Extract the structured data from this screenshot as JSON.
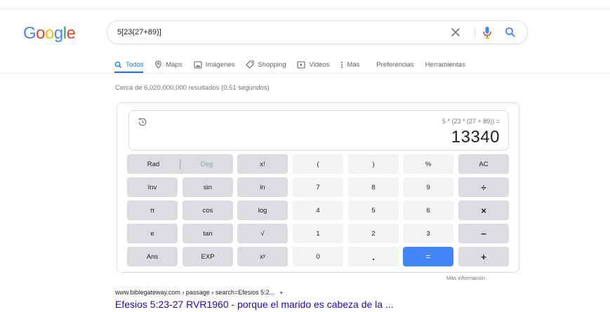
{
  "logo": {
    "letters": [
      "G",
      "o",
      "o",
      "g",
      "l",
      "e"
    ],
    "colors": [
      "#4285f4",
      "#ea4335",
      "#fbbc05",
      "#4285f4",
      "#34a853",
      "#ea4335"
    ]
  },
  "search": {
    "query": "5[23(27+89)]"
  },
  "tabs": [
    {
      "label": "Todos",
      "icon": "search-icon",
      "active": true
    },
    {
      "label": "Maps",
      "icon": "location-icon"
    },
    {
      "label": "Imágenes",
      "icon": "image-icon"
    },
    {
      "label": "Shopping",
      "icon": "tag-icon"
    },
    {
      "label": "Videos",
      "icon": "play-icon"
    },
    {
      "label": "Más",
      "icon": "more-vert-icon"
    },
    {
      "label": "Preferencias"
    },
    {
      "label": "Herramientas"
    }
  ],
  "stats": "Cerca de 6,020,000,000 resultados (0.51 segundos)",
  "calculator": {
    "expression": "5 * (23 * (27 + 89)) =",
    "result": "13340",
    "rows": [
      [
        "Rad",
        "Deg",
        "x!",
        "(",
        ")",
        "%",
        "AC"
      ],
      [
        "Inv",
        "sin",
        "ln",
        "7",
        "8",
        "9",
        "÷"
      ],
      [
        "π",
        "cos",
        "log",
        "4",
        "5",
        "6",
        "×"
      ],
      [
        "e",
        "tan",
        "√",
        "1",
        "2",
        "3",
        "−"
      ],
      [
        "Ans",
        "EXP",
        "xʸ",
        "0",
        ".",
        "=",
        "+"
      ]
    ],
    "more_info": "Más información"
  },
  "result_item": {
    "url": "www.biblegateway.com › passage › search=Efesios 5:2...",
    "title": "Efesios 5:23-27 RVR1960 - porque el marido es cabeza de la ..."
  },
  "colors": {
    "accent": "#1a73e8",
    "equals": "#4285f4",
    "link": "#1a0dab"
  }
}
